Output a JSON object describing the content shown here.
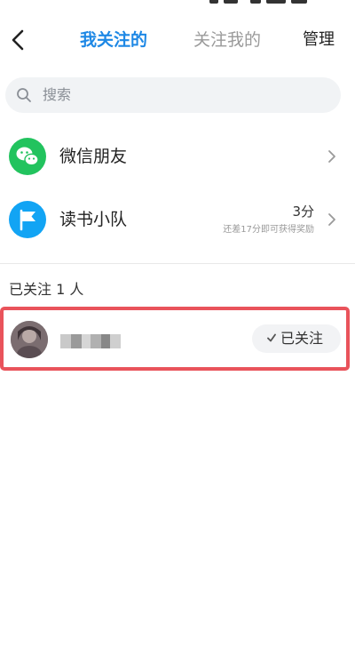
{
  "header": {
    "tabs": [
      {
        "label": "我关注的",
        "active": true
      },
      {
        "label": "关注我的",
        "active": false
      }
    ],
    "manage_label": "管理"
  },
  "search": {
    "placeholder": "搜索"
  },
  "list": {
    "items": [
      {
        "label": "微信朋友",
        "icon": "wechat-icon"
      },
      {
        "label": "读书小队",
        "icon": "flag-icon",
        "points": "3分",
        "hint": "还差17分即可获得奖励"
      }
    ]
  },
  "following": {
    "count_label": "已关注 1 人",
    "users": [
      {
        "follow_label": "已关注"
      }
    ]
  },
  "colors": {
    "accent": "#1e88e5",
    "wechat": "#22c35e",
    "team": "#12a4f4",
    "highlight": "#e9535b"
  }
}
